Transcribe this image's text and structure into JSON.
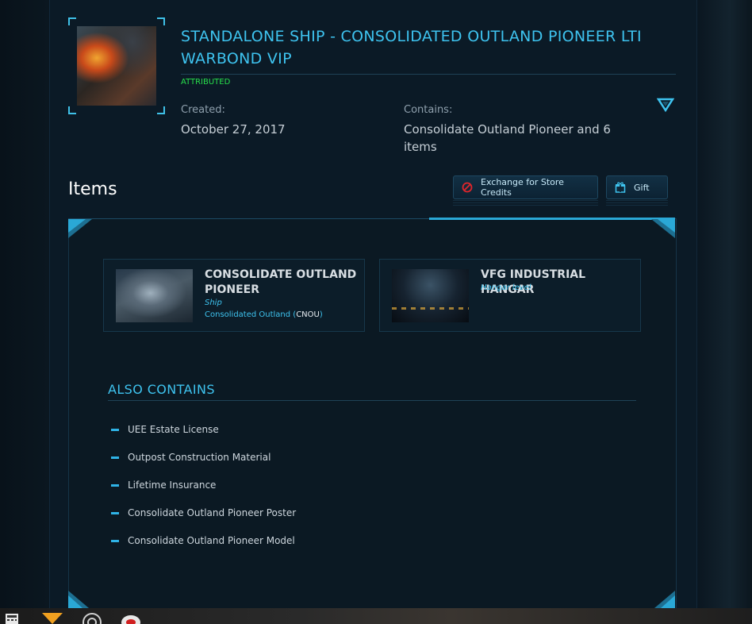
{
  "pledge": {
    "title": "STANDALONE SHIP - CONSOLIDATED OUTLAND PIONEER LTI WARBOND VIP",
    "status": "ATTRIBUTED",
    "created_label": "Created:",
    "created_value": "October 27, 2017",
    "contains_label": "Contains:",
    "contains_value": "Consolidate Outland Pioneer and 6 items"
  },
  "items_section": {
    "heading": "Items",
    "exchange_label": "Exchange for Store Credits",
    "gift_label": "Gift"
  },
  "cards": [
    {
      "title": "CONSOLIDATE OUTLAND PIONEER",
      "type": "Ship",
      "manufacturer": "Consolidated Outland (",
      "code": "CNOU",
      "close": ")"
    },
    {
      "title": "VFG INDUSTRIAL HANGAR",
      "type": "Hangar level"
    }
  ],
  "also_contains": {
    "heading": "ALSO CONTAINS",
    "items": [
      "UEE Estate License",
      "Outpost Construction Material",
      "Lifetime Insurance",
      "Consolidate Outland Pioneer Poster",
      "Consolidate Outland Pioneer Model"
    ]
  },
  "colors": {
    "accent": "#3ec3ef",
    "status_green": "#27e04b",
    "background": "#0b1a26"
  }
}
